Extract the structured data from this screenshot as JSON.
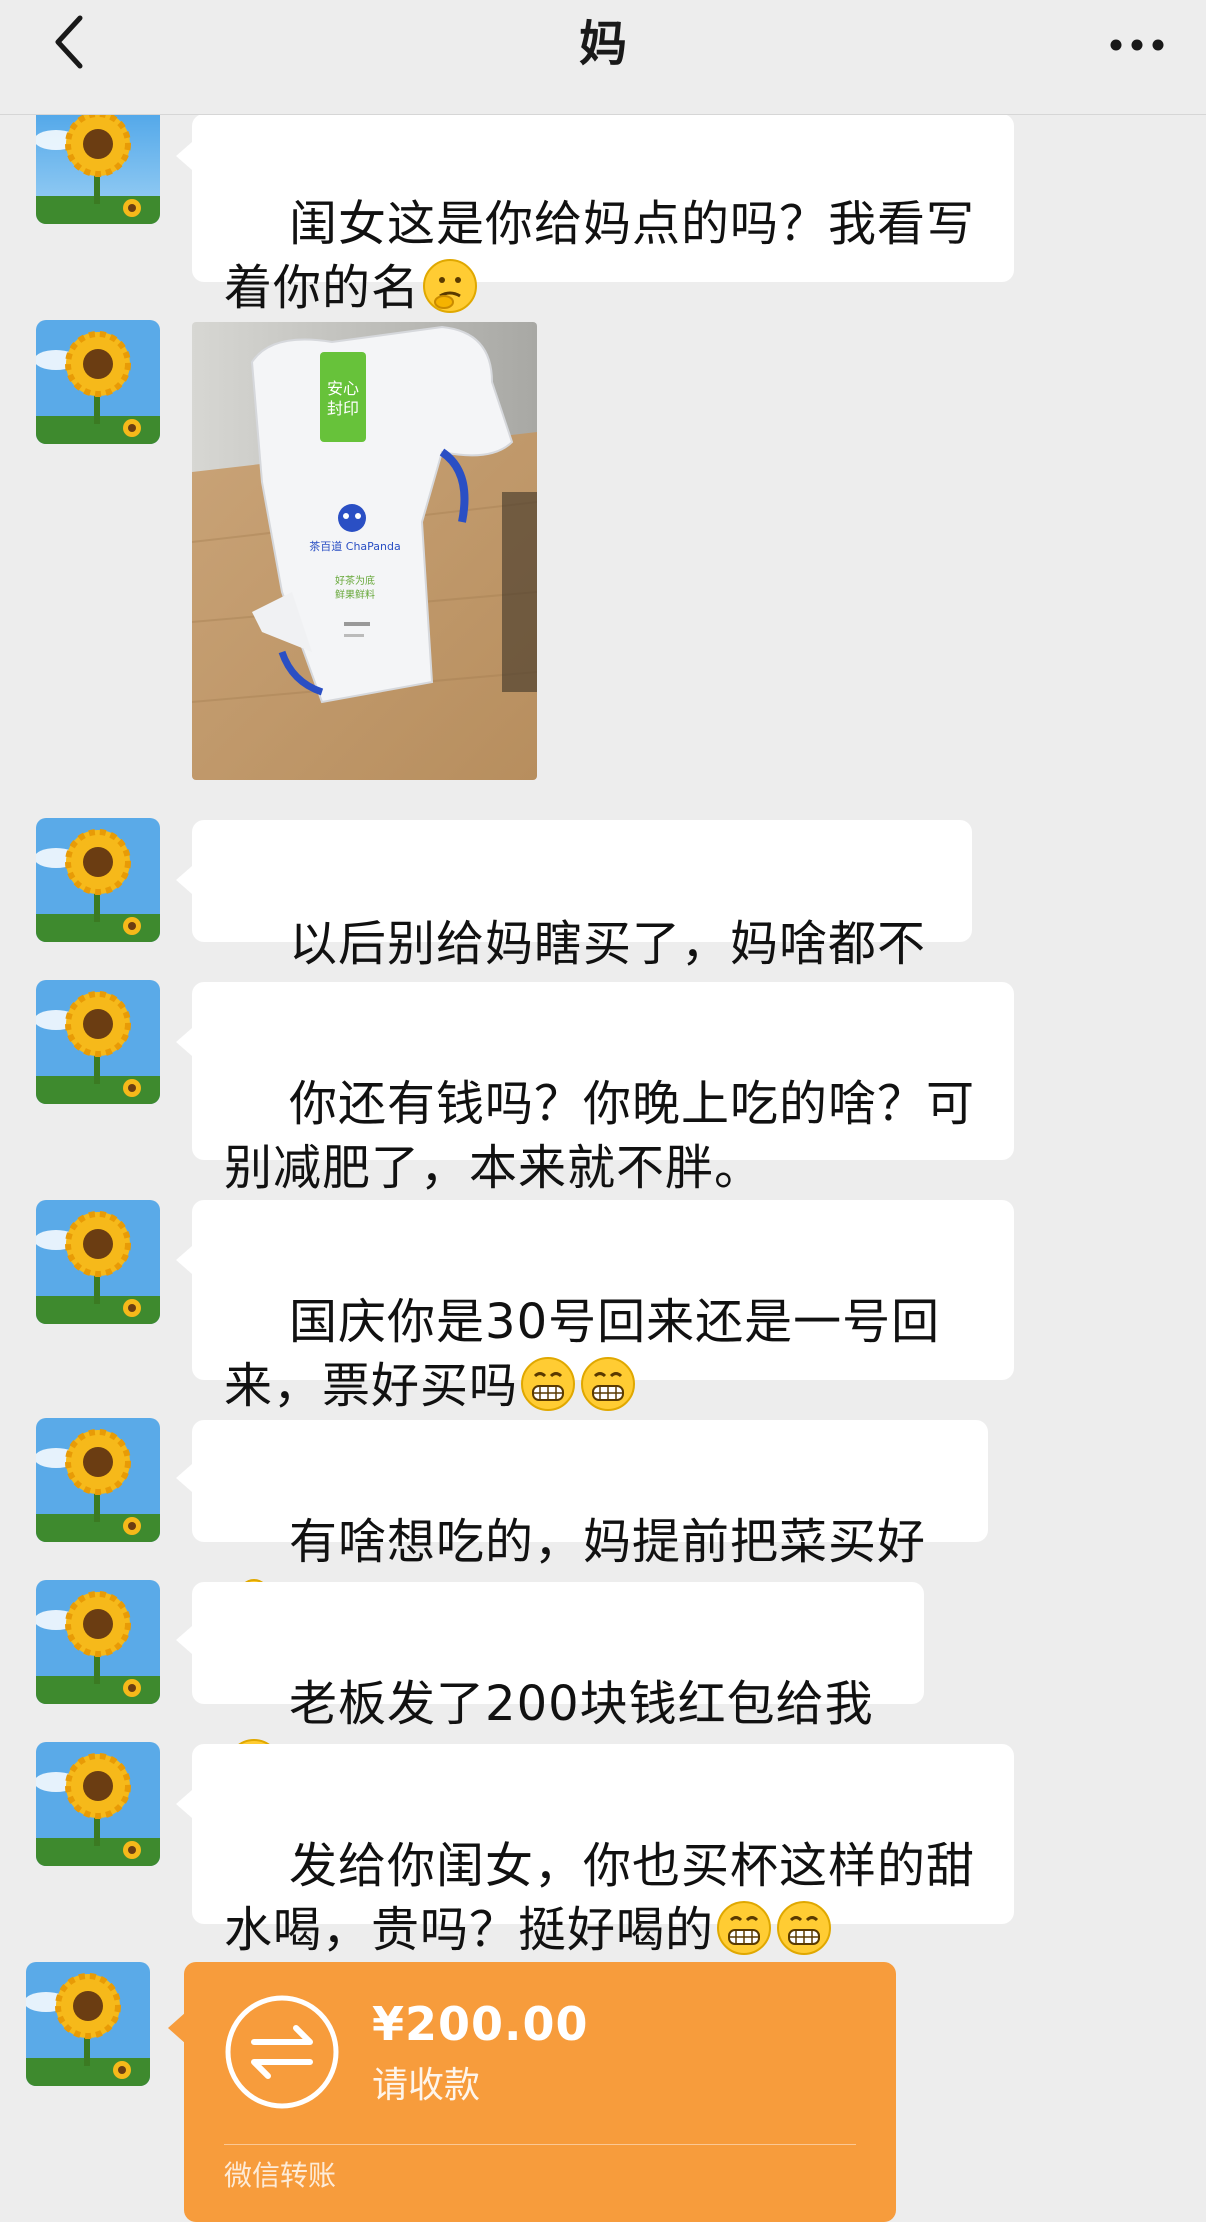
{
  "header": {
    "title": "妈",
    "back_icon": "chevron-left-icon",
    "more_icon": "more-dots-icon"
  },
  "messages": [
    {
      "type": "text",
      "parts": [
        "闺女这是你给妈点的吗？我看写着你的名",
        ""
      ],
      "emoji": [
        "thinking-face"
      ]
    },
    {
      "type": "image",
      "description_icon": "photo-bag"
    },
    {
      "type": "text",
      "parts": [
        "以后别给妈瞎买了，妈啥都不缺"
      ]
    },
    {
      "type": "text",
      "parts": [
        "你还有钱吗？你晚上吃的啥？可别减肥了，本来就不胖。"
      ]
    },
    {
      "type": "text",
      "parts": [
        "国庆你是30号回来还是一号回来，票好买吗"
      ],
      "emoji": [
        "grin",
        "grin"
      ]
    },
    {
      "type": "text",
      "parts": [
        "有啥想吃的，妈提前把菜买好"
      ],
      "emoji": [
        "shrug-figure"
      ]
    },
    {
      "type": "text",
      "parts": [
        "老板发了200块钱红包给我"
      ],
      "emoji": [
        "thinking-face"
      ]
    },
    {
      "type": "text",
      "parts": [
        "发给你闺女，你也买杯这样的甜水喝，贵吗？挺好喝的"
      ],
      "emoji": [
        "grin",
        "grin"
      ]
    }
  ],
  "transfer": {
    "amount": "¥200.00",
    "status": "请收款",
    "footer": "微信转账",
    "color": "#f79c3c"
  },
  "colors": {
    "background": "#ededed",
    "bubble": "#ffffff",
    "transfer": "#f79c3c"
  }
}
